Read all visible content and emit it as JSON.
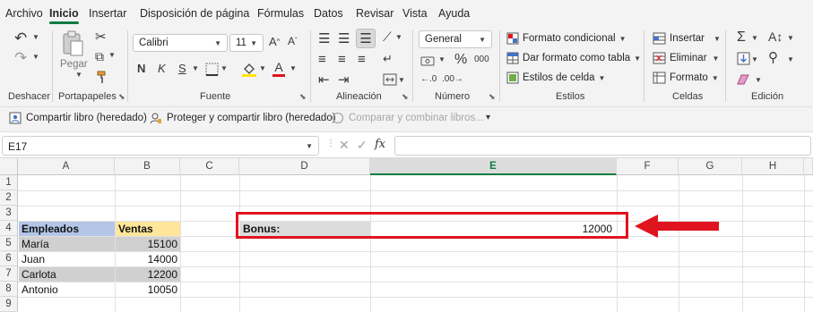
{
  "menu": {
    "tabs": [
      "Archivo",
      "Inicio",
      "Insertar",
      "Disposición de página",
      "Fórmulas",
      "Datos",
      "Revisar",
      "Vista",
      "Ayuda"
    ]
  },
  "ribbon": {
    "groups": {
      "undo": "Deshacer",
      "clipboard": "Portapapeles",
      "font": "Fuente",
      "alignment": "Alineación",
      "number": "Número",
      "styles": "Estilos",
      "cells": "Celdas",
      "editing": "Edición"
    },
    "paste_label": "Pegar",
    "font_name": "Calibri",
    "font_size": "11",
    "number_format": "General",
    "styles_buttons": [
      "Formato condicional",
      "Dar formato como tabla",
      "Estilos de celda"
    ],
    "cells_buttons": [
      "Insertar",
      "Eliminar",
      "Formato"
    ],
    "bold_glyph": "N",
    "italic_glyph": "K",
    "underline_glyph": "S"
  },
  "quick_access": {
    "share": "Compartir libro (heredado)",
    "protect": "Proteger y compartir libro (heredado)",
    "compare": "Comparar y combinar libros..."
  },
  "formula_bar": {
    "name_box": "E17",
    "fx": "fx",
    "formula": ""
  },
  "sheet": {
    "columns": [
      "A",
      "B",
      "C",
      "D",
      "E",
      "F",
      "G",
      "H"
    ],
    "selected_column": "E",
    "rows": [
      "1",
      "2",
      "3",
      "4",
      "5",
      "6",
      "7",
      "8",
      "9"
    ],
    "headers": {
      "employees": "Empleados",
      "sales": "Ventas"
    },
    "employees": [
      {
        "name": "María",
        "sales": "15100"
      },
      {
        "name": "Juan",
        "sales": "14000"
      },
      {
        "name": "Carlota",
        "sales": "12200"
      },
      {
        "name": "Antonio",
        "sales": "10050"
      }
    ],
    "bonus_label": "Bonus:",
    "bonus_value": "12000"
  },
  "colors": {
    "accent_green": "#107c41",
    "header_blue": "#b4c6e7",
    "header_yellow": "#ffe699",
    "row_gray": "#d0d0d0",
    "highlight_red": "#e0141e"
  }
}
